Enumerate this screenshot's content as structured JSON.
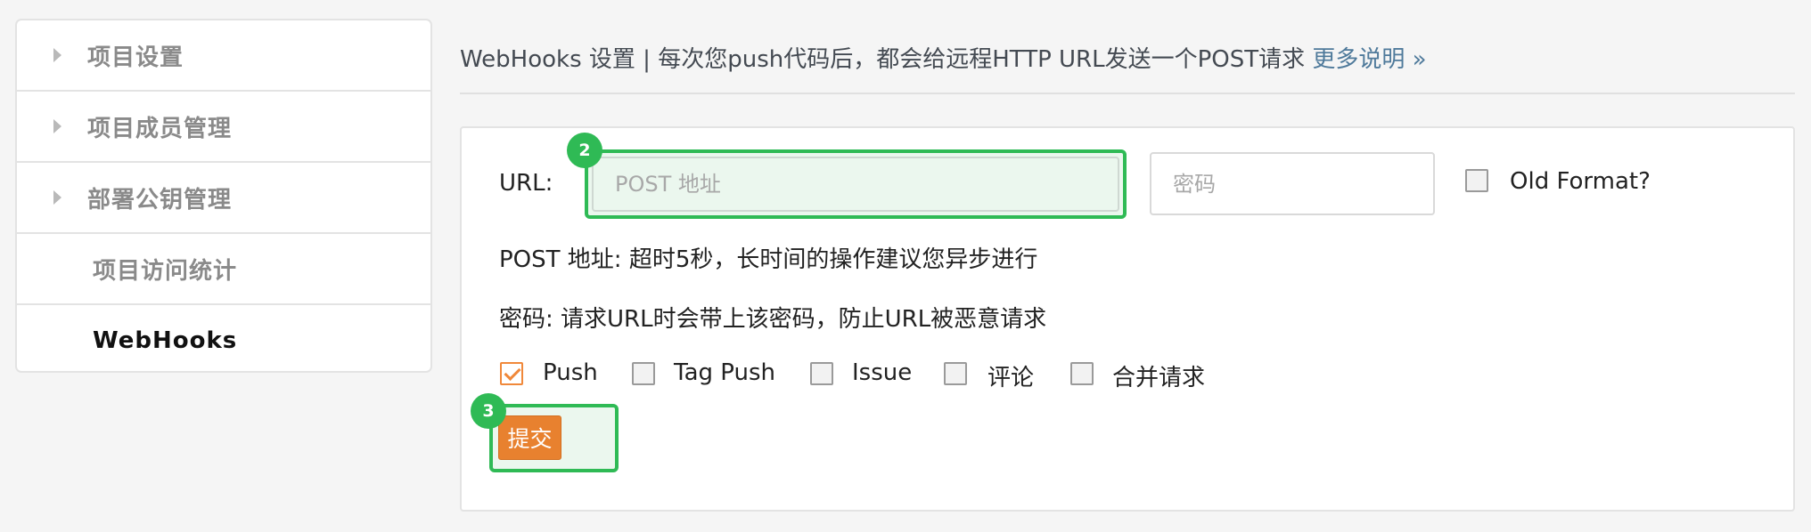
{
  "sidebar": {
    "items": [
      {
        "label": "项目设置",
        "expandable": true,
        "active": false
      },
      {
        "label": "项目成员管理",
        "expandable": true,
        "active": false
      },
      {
        "label": "部署公钥管理",
        "expandable": true,
        "active": false
      },
      {
        "label": "项目访问统计",
        "expandable": false,
        "active": false
      },
      {
        "label": "WebHooks",
        "expandable": false,
        "active": true
      }
    ]
  },
  "header": {
    "title": "WebHooks 设置 | 每次您push代码后，都会给远程HTTP URL发送一个POST请求",
    "more_link": "更多说明 »"
  },
  "form": {
    "url_label": "URL:",
    "url_placeholder": "POST 地址",
    "url_value": "",
    "password_placeholder": "密码",
    "password_value": "",
    "old_format_label": "Old Format?",
    "old_format_checked": false,
    "help_url": "POST 地址: 超时5秒，长时间的操作建议您异步进行",
    "help_password": "密码: 请求URL时会带上该密码，防止URL被恶意请求",
    "events": [
      {
        "label": "Push",
        "checked": true
      },
      {
        "label": "Tag Push",
        "checked": false
      },
      {
        "label": "Issue",
        "checked": false
      },
      {
        "label": "评论",
        "checked": false
      },
      {
        "label": "合并请求",
        "checked": false
      }
    ],
    "submit_label": "提交"
  },
  "annotations": {
    "badge_url": "2",
    "badge_submit": "3"
  },
  "colors": {
    "accent": "#e8812f",
    "highlight": "#2fba55",
    "link": "#4f7a9b"
  }
}
